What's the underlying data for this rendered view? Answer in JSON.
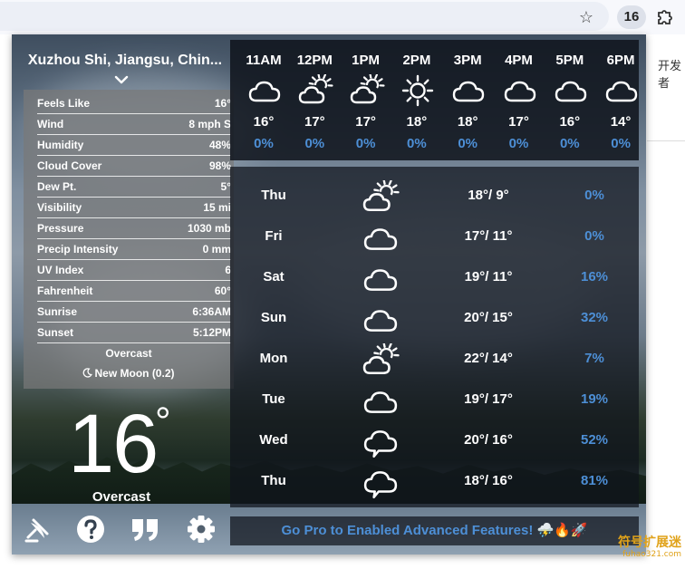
{
  "browser": {
    "extension_badge": "16",
    "star_icon": "star-icon",
    "puzzle_icon": "puzzle-icon",
    "background_text": "开发者"
  },
  "location": {
    "name": "Xuzhou Shi, Jiangsu, Chin..."
  },
  "details": [
    {
      "label": "Feels Like",
      "value": "16°"
    },
    {
      "label": "Wind",
      "value": "8 mph S"
    },
    {
      "label": "Humidity",
      "value": "48%"
    },
    {
      "label": "Cloud Cover",
      "value": "98%"
    },
    {
      "label": "Dew Pt.",
      "value": "5°"
    },
    {
      "label": "Visibility",
      "value": "15 mi"
    },
    {
      "label": "Pressure",
      "value": "1030 mb"
    },
    {
      "label": "Precip Intensity",
      "value": "0 mm"
    },
    {
      "label": "UV Index",
      "value": "6"
    },
    {
      "label": "Fahrenheit",
      "value": "60°"
    },
    {
      "label": "Sunrise",
      "value": "6:36AM"
    },
    {
      "label": "Sunset",
      "value": "5:12PM"
    }
  ],
  "summary": {
    "condition": "Overcast",
    "moon": "New Moon (0.2)"
  },
  "current": {
    "temp": "16",
    "degree": "°",
    "condition": "Overcast"
  },
  "hourly": [
    {
      "time": "11AM",
      "icon": "cloud",
      "temp": "16°",
      "precip": "0%"
    },
    {
      "time": "12PM",
      "icon": "partly-cloudy",
      "temp": "17°",
      "precip": "0%"
    },
    {
      "time": "1PM",
      "icon": "partly-cloudy",
      "temp": "17°",
      "precip": "0%"
    },
    {
      "time": "2PM",
      "icon": "sun",
      "temp": "18°",
      "precip": "0%"
    },
    {
      "time": "3PM",
      "icon": "cloud",
      "temp": "18°",
      "precip": "0%"
    },
    {
      "time": "4PM",
      "icon": "cloud",
      "temp": "17°",
      "precip": "0%"
    },
    {
      "time": "5PM",
      "icon": "cloud",
      "temp": "16°",
      "precip": "0%"
    },
    {
      "time": "6PM",
      "icon": "cloud",
      "temp": "14°",
      "precip": "0%"
    }
  ],
  "daily": [
    {
      "day": "Thu",
      "icon": "partly-cloudy",
      "range": "18°/ 9°",
      "precip": "0%"
    },
    {
      "day": "Fri",
      "icon": "cloud",
      "range": "17°/ 11°",
      "precip": "0%"
    },
    {
      "day": "Sat",
      "icon": "cloud",
      "range": "19°/ 11°",
      "precip": "16%"
    },
    {
      "day": "Sun",
      "icon": "cloud",
      "range": "20°/ 15°",
      "precip": "32%"
    },
    {
      "day": "Mon",
      "icon": "partly-cloudy",
      "range": "22°/ 14°",
      "precip": "7%"
    },
    {
      "day": "Tue",
      "icon": "cloud",
      "range": "19°/ 17°",
      "precip": "19%"
    },
    {
      "day": "Wed",
      "icon": "speech-cloud",
      "range": "20°/ 16°",
      "precip": "52%"
    },
    {
      "day": "Thu",
      "icon": "speech-cloud",
      "range": "18°/ 16°",
      "precip": "81%"
    }
  ],
  "promo": {
    "text": "Go Pro to Enabled Advanced Features! ⛈️🔥🚀"
  },
  "toolbar": [
    {
      "icon": "satellite-icon"
    },
    {
      "icon": "help-icon"
    },
    {
      "icon": "quote-icon"
    },
    {
      "icon": "settings-icon"
    }
  ],
  "watermark": {
    "text": "符号扩展迷",
    "sub": "fuhao321.com"
  },
  "colors": {
    "precip_blue": "#4d8fd6",
    "panel_dark": "#0f141c",
    "details_gray": "#787878"
  }
}
